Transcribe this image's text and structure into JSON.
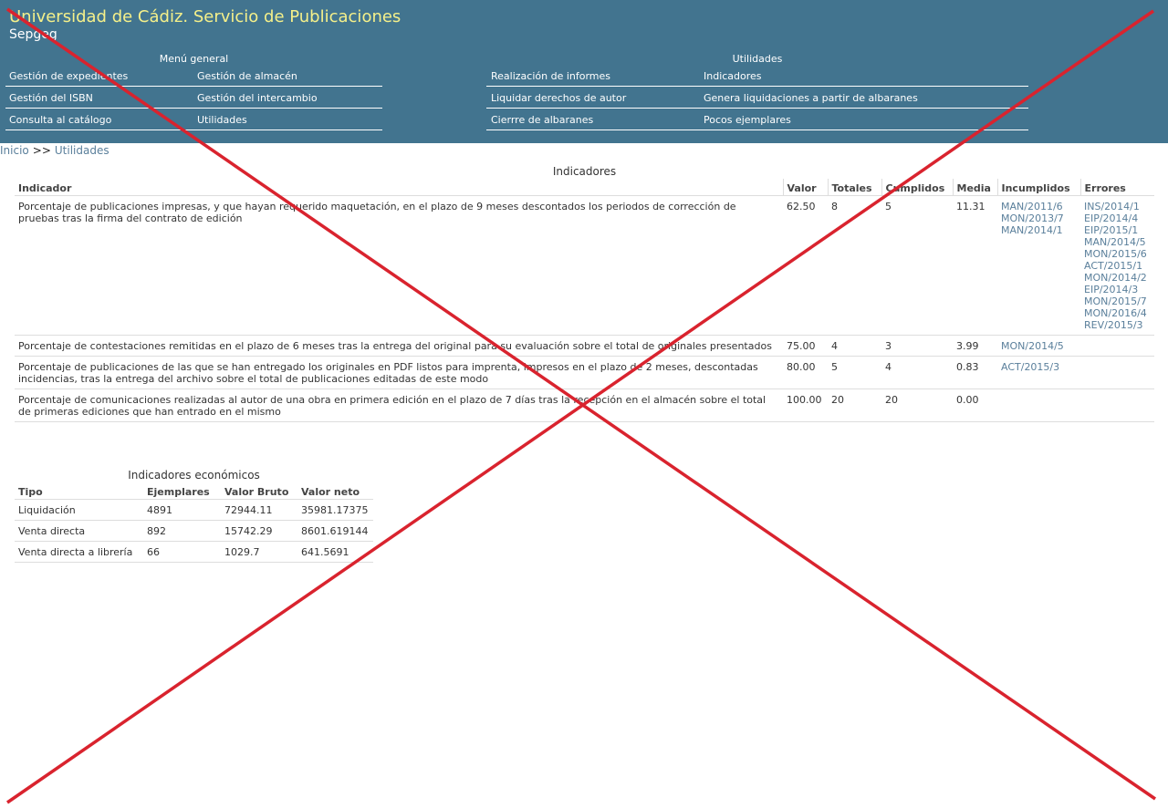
{
  "header": {
    "title": "Universidad de Cádiz. Servicio de Publicaciones",
    "subtitle": "Sepgeg"
  },
  "menu_general": {
    "title": "Menú general",
    "items": [
      "Gestión de expedientes",
      "Gestión de almacén",
      "Gestión del ISBN",
      "Gestión del intercambio",
      "Consulta al catálogo",
      "Utilidades"
    ]
  },
  "menu_utilidades": {
    "title": "Utilidades",
    "items": [
      "Realización de informes",
      "Indicadores",
      "Liquidar derechos de autor",
      "Genera liquidaciones a partir de albaranes",
      "Cierrre de albaranes",
      "Pocos ejemplares"
    ]
  },
  "breadcrumb": {
    "home": "Inicio",
    "separator": ">>",
    "current": "Utilidades"
  },
  "indicadores": {
    "caption": "Indicadores",
    "headers": [
      "Indicador",
      "Valor",
      "Totales",
      "Cumplidos",
      "Media",
      "Incumplidos",
      "Errores"
    ],
    "rows": [
      {
        "indicador": "Porcentaje de publicaciones impresas, y que hayan requerido maquetación, en el plazo de 9 meses descontados los periodos de corrección de pruebas tras la firma del contrato de edición",
        "valor": "62.50",
        "totales": "8",
        "cumplidos": "5",
        "media": "11.31",
        "incumplidos": [
          "MAN/2011/6",
          "MON/2013/7",
          "MAN/2014/1"
        ],
        "errores": [
          "INS/2014/1",
          "EIP/2014/4",
          "EIP/2015/1",
          "MAN/2014/5",
          "MON/2015/6",
          "ACT/2015/1",
          "MON/2014/2",
          "EIP/2014/3",
          "MON/2015/7",
          "MON/2016/4",
          "REV/2015/3"
        ]
      },
      {
        "indicador": "Porcentaje de contestaciones remitidas en el plazo de 6 meses tras la entrega del original para su evaluación sobre el total de originales presentados",
        "valor": "75.00",
        "totales": "4",
        "cumplidos": "3",
        "media": "3.99",
        "incumplidos": [
          "MON/2014/5"
        ],
        "errores": []
      },
      {
        "indicador": "Porcentaje de publicaciones de las que se han entregado los originales en PDF listos para imprenta, impresos en el plazo de 2 meses, descontadas incidencias, tras la entrega del archivo sobre el total de publicaciones editadas de este modo",
        "valor": "80.00",
        "totales": "5",
        "cumplidos": "4",
        "media": "0.83",
        "incumplidos": [
          "ACT/2015/3"
        ],
        "errores": []
      },
      {
        "indicador": "Porcentaje de comunicaciones realizadas al autor de una obra en primera edición en el plazo de 7 días tras la recepción en el almacén sobre el total de primeras ediciones que han entrado en el mismo",
        "valor": "100.00",
        "totales": "20",
        "cumplidos": "20",
        "media": "0.00",
        "incumplidos": [],
        "errores": []
      }
    ]
  },
  "economicos": {
    "caption": "Indicadores económicos",
    "headers": [
      "Tipo",
      "Ejemplares",
      "Valor Bruto",
      "Valor neto"
    ],
    "rows": [
      [
        "Liquidación",
        "4891",
        "72944.11",
        "35981.17375"
      ],
      [
        "Venta directa",
        "892",
        "15742.29",
        "8601.619144"
      ],
      [
        "Venta directa a librería",
        "66",
        "1029.7",
        "641.5691"
      ]
    ]
  },
  "colors": {
    "header_bg": "#42748f",
    "title": "#f5f08a",
    "link": "#5a7f9b",
    "cross": "#d9232e"
  }
}
